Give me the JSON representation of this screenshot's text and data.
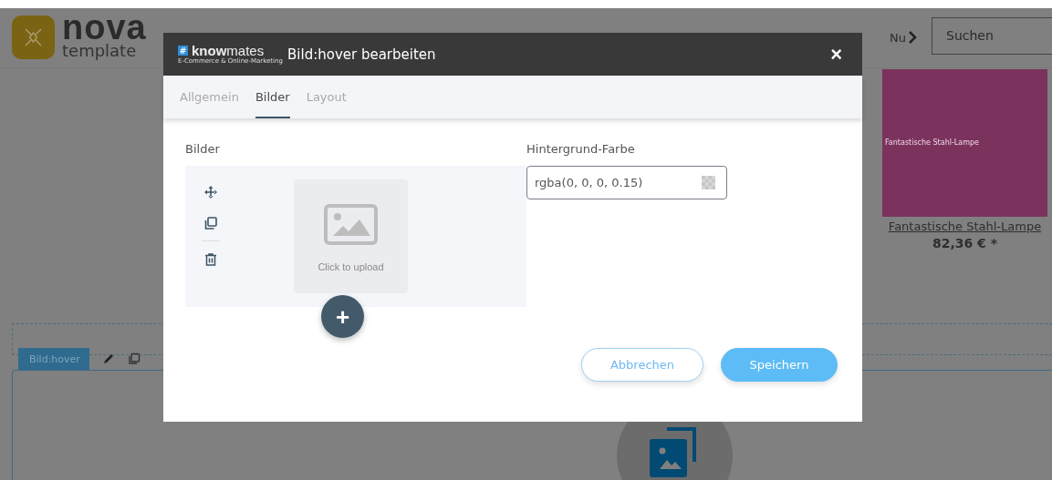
{
  "page": {
    "logo": {
      "word": "nova",
      "sub": "template"
    },
    "nav_item": "Nu",
    "search": {
      "placeholder": "Suchen"
    },
    "product": {
      "image_caption": "Fantastische Stahl-Lampe",
      "title": "Fantastische Stahl-Lampe",
      "price": "82,36 € *"
    },
    "element_tab": {
      "label": "Bild:hover"
    }
  },
  "dialog": {
    "brand": {
      "mark": "#",
      "name": "**know**mates",
      "tagline": "E-Commerce & Online-Marketing"
    },
    "title": "Bild:hover bearbeiten",
    "close": "×",
    "tabs": [
      {
        "label": "Allgemein",
        "selected": false
      },
      {
        "label": "Bilder",
        "selected": true
      },
      {
        "label": "Layout",
        "selected": false
      }
    ],
    "images": {
      "label": "Bilder",
      "upload_hint": "Click to upload",
      "add": "+"
    },
    "background_color": {
      "label": "Hintergrund-Farbe",
      "value": "rgba(0, 0, 0, 0.15)"
    },
    "buttons": [
      {
        "label": "Abbrechen",
        "kind": "secondary"
      },
      {
        "label": "Speichern",
        "kind": "primary"
      }
    ]
  }
}
